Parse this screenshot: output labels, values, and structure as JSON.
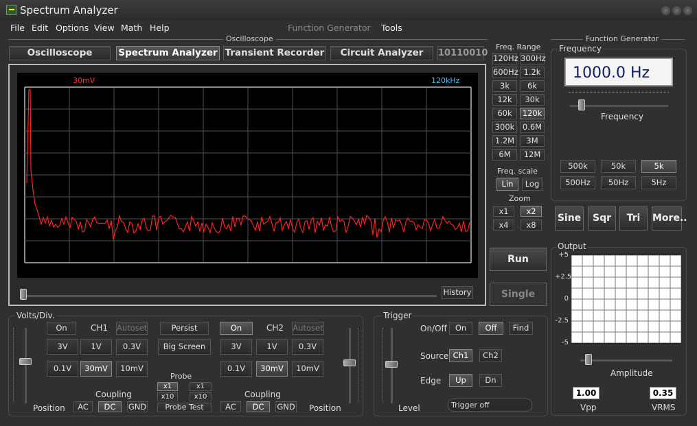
{
  "window": {
    "title": "Spectrum Analyzer"
  },
  "menu": [
    "File",
    "Edit",
    "Options",
    "View",
    "Math",
    "Help"
  ],
  "menu_dim": "Function Generator",
  "menu_tools": "Tools",
  "groups": {
    "oscilloscope": "Oscilloscope",
    "function_generator": "Function Generator"
  },
  "tabs": [
    "Oscilloscope",
    "Spectrum Analyzer",
    "Transient Recorder",
    "Circuit Analyzer"
  ],
  "digital_tab": "10110010",
  "scope": {
    "volt_label": "30mV",
    "freq_label": "120kHz",
    "history": "History"
  },
  "freq_range": {
    "title": "Freq. Range",
    "buttons": [
      "120Hz",
      "300Hz",
      "600Hz",
      "1.2k",
      "3k",
      "6k",
      "12k",
      "30k",
      "60k",
      "120k",
      "300k",
      "0.6M",
      "1.2M",
      "3M",
      "6M",
      "12M"
    ],
    "selected": "120k"
  },
  "freq_scale": {
    "title": "Freq. scale",
    "lin": "Lin",
    "log": "Log"
  },
  "zoom": {
    "title": "Zoom",
    "buttons": [
      "x1",
      "x2",
      "x4",
      "x8"
    ],
    "selected": "x2"
  },
  "run": {
    "run": "Run",
    "single": "Single"
  },
  "funcgen": {
    "frequency_title": "Frequency",
    "display": "1000.0 Hz",
    "slider_label": "Frequency",
    "range_buttons": [
      "500k",
      "50k",
      "5k",
      "500Hz",
      "50Hz",
      "5Hz"
    ],
    "selected": "5k",
    "waves": [
      "Sine",
      "Sqr",
      "Tri",
      "More.."
    ],
    "output_title": "Output",
    "y_ticks": [
      "+5",
      "+2.5",
      "0",
      "-2.5",
      "-5"
    ],
    "amplitude_label": "Amplitude",
    "vpp": "1.00",
    "vpp_label": "Vpp",
    "vrms": "0.35",
    "vrms_label": "VRMS"
  },
  "volts": {
    "title": "Volts/Div.",
    "on": "On",
    "ch1": "CH1",
    "ch2": "CH2",
    "autoset": "Autoset",
    "persist": "Persist",
    "big_screen": "Big Screen",
    "v_buttons": [
      "3V",
      "1V",
      "0.3V",
      "0.1V",
      "30mV",
      "10mV"
    ],
    "selected": "30mV",
    "probe": "Probe",
    "x1": "x1",
    "x10": "x10",
    "probe_test": "Probe Test",
    "coupling": "Coupling",
    "ac": "AC",
    "dc": "DC",
    "gnd": "GND",
    "position": "Position"
  },
  "trigger": {
    "title": "Trigger",
    "onoff": "On/Off",
    "on": "On",
    "off": "Off",
    "find": "Find",
    "source": "Source",
    "ch1": "Ch1",
    "ch2": "Ch2",
    "edge": "Edge",
    "up": "Up",
    "dn": "Dn",
    "level": "Level",
    "status": "Trigger off"
  },
  "colors": {
    "trace": "#ff2020",
    "volt_label": "#ff3030",
    "freq_label": "#40c0ff",
    "grid": "#505050"
  },
  "chart_data": {
    "type": "line",
    "xlim": [
      0,
      120000
    ],
    "ylabel": "",
    "xlabel": "",
    "series": [
      {
        "values": []
      }
    ]
  }
}
